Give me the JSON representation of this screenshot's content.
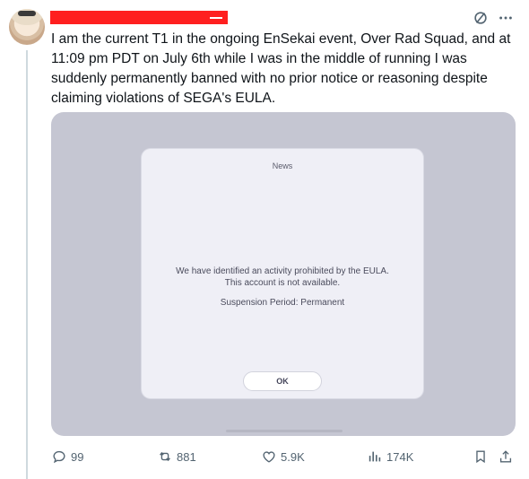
{
  "tweet": {
    "text": "I am the current T1 in the ongoing EnSekai event, Over Rad Squad, and at\n11:09 pm PDT on July 6th while I was in the middle of running I was\nsuddenly permanently banned with no prior notice or reasoning despite\nclaiming violations of SEGA's EULA.",
    "redaction_color": "#ff1f1f"
  },
  "icons": {
    "grok": "slash-circle-icon",
    "more": "more-dots-icon"
  },
  "dialog": {
    "title": "News",
    "message": "We have identified an activity prohibited by the EULA.\nThis account is not available.",
    "period": "Suspension Period: Permanent",
    "ok_label": "OK"
  },
  "actions": {
    "reply_count": "99",
    "retweet_count": "881",
    "like_count": "5.9K",
    "views_count": "174K"
  },
  "colors": {
    "text": "#0f1419",
    "muted": "#536471",
    "media_bg": "#c5c6d2",
    "dialog_bg": "#efeff6"
  }
}
